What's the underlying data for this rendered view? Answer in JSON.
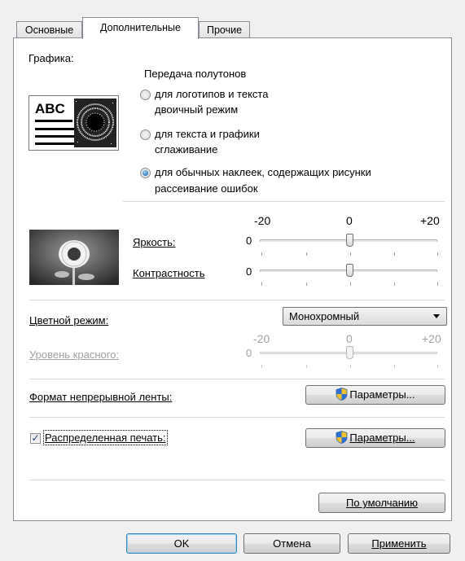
{
  "tabs": [
    {
      "label": "Основные",
      "active": false
    },
    {
      "label": "Дополнительные",
      "active": true
    },
    {
      "label": "Прочие",
      "active": false
    }
  ],
  "graphics": {
    "label": "Графика:",
    "preview_text": "ABC",
    "halftone_title": "Передача полутонов",
    "options": [
      {
        "line1": "для логотипов и текста",
        "line2": "двоичный режим",
        "selected": false
      },
      {
        "line1": "для текста и графики",
        "line2": "сглаживание",
        "selected": false
      },
      {
        "line1": "для обычных наклеек, содержащих рисунки",
        "line2": "рассеивание ошибок",
        "selected": true
      }
    ]
  },
  "adjust": {
    "scale_min": "-20",
    "scale_mid": "0",
    "scale_max": "+20",
    "brightness": {
      "label": "Яркость:",
      "value": "0",
      "level": 0.5
    },
    "contrast": {
      "label": "Контрастность",
      "value": "0",
      "level": 0.5
    }
  },
  "color": {
    "label": "Цветной режим:",
    "selected": "Монохромный",
    "scale_min": "-20",
    "scale_mid": "0",
    "scale_max": "+20",
    "red_label": "Уровень красного:",
    "red_value": "0",
    "red_level": 0.5
  },
  "continuous": {
    "label": "Формат непрерывной ленты:",
    "button": "Параметры..."
  },
  "distributed": {
    "label": "Распределенная печать:",
    "checked": true,
    "button": "Параметры..."
  },
  "default_button": "По умолчанию",
  "footer": {
    "ok": "OK",
    "cancel": "Отмена",
    "apply": "Применить"
  },
  "colors": {
    "accent": "#1b6bb6",
    "border": "#898c95",
    "panel": "#ffffff",
    "window": "#f0f0f0"
  }
}
